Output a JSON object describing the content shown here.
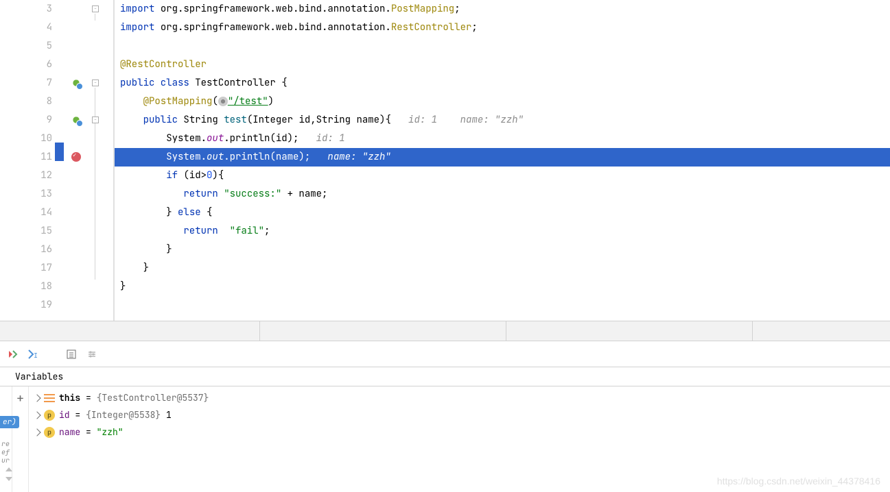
{
  "lines": {
    "3": {
      "num": "3"
    },
    "4": {
      "num": "4"
    },
    "5": {
      "num": "5"
    },
    "6": {
      "num": "6"
    },
    "7": {
      "num": "7"
    },
    "8": {
      "num": "8"
    },
    "9": {
      "num": "9"
    },
    "10": {
      "num": "10"
    },
    "11": {
      "num": "11"
    },
    "12": {
      "num": "12"
    },
    "13": {
      "num": "13"
    },
    "14": {
      "num": "14"
    },
    "15": {
      "num": "15"
    },
    "16": {
      "num": "16"
    },
    "17": {
      "num": "17"
    },
    "18": {
      "num": "18"
    },
    "19": {
      "num": "19"
    }
  },
  "code": {
    "l3_import": "import ",
    "l3_pkg": "org.springframework.web.bind.annotation.",
    "l3_cls": "PostMapping",
    "l3_semi": ";",
    "l4_import": "import ",
    "l4_pkg": "org.springframework.web.bind.annotation.",
    "l4_cls": "RestController",
    "l4_semi": ";",
    "l6_ann": "@RestController",
    "l7_public": "public class ",
    "l7_name": "TestController {",
    "l8_ann": "@PostMapping",
    "l8_open": "(",
    "l8_str": "\"/test\"",
    "l8_close": ")",
    "l9_public": "public ",
    "l9_type": "String ",
    "l9_method": "test",
    "l9_params": "(Integer id,String name){",
    "l9_hint": "   id: 1    name: \"zzh\"",
    "l10_sys": "System.",
    "l10_out": "out",
    "l10_println": ".println(id);",
    "l10_hint": "   id: 1",
    "l11_sys": "System.",
    "l11_out": "out",
    "l11_println": ".println(name);",
    "l11_hint": "   name: \"zzh\"",
    "l12_if": "if ",
    "l12_cond": "(id>",
    "l12_zero": "0",
    "l12_close": "){",
    "l13_return": "return ",
    "l13_str": "\"success:\"",
    "l13_plus": " + name;",
    "l14_else": "} ",
    "l14_kw": "else",
    "l14_brace": " {",
    "l15_return": "return  ",
    "l15_str": "\"fail\"",
    "l15_semi": ";",
    "l16_brace": "}",
    "l17_brace": "}",
    "l18_brace": "}"
  },
  "debug": {
    "variables_label": "Variables",
    "rows": {
      "this_name": "this",
      "this_eq": " = ",
      "this_val": "{TestController@5537}",
      "id_name": "id",
      "id_eq": " = ",
      "id_val": "{Integer@5538} ",
      "id_num": "1",
      "name_name": "name",
      "name_eq": " = ",
      "name_val": "\"zzh\""
    },
    "badge_p": "p",
    "left_badge": "er)"
  },
  "watermark": "https://blog.csdn.net/weixin_44378416"
}
